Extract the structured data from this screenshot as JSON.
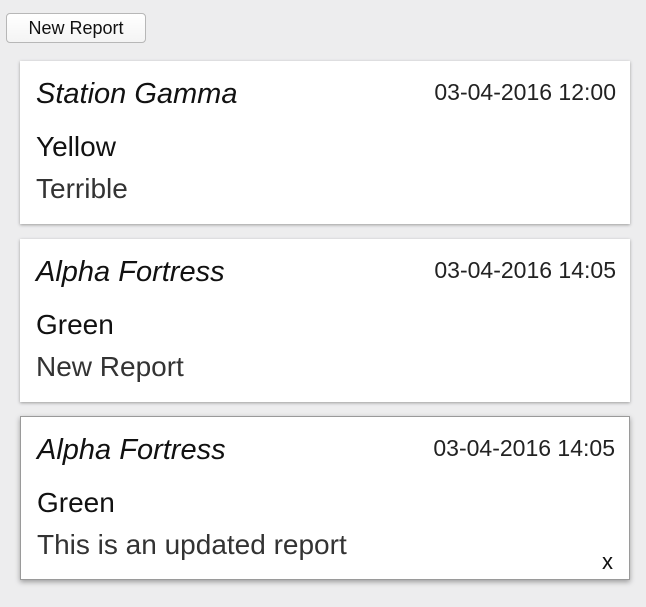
{
  "toolbar": {
    "new_report_label": "New Report"
  },
  "reports": [
    {
      "station": "Station Gamma",
      "timestamp": "03-04-2016 12:00",
      "status": "Yellow",
      "message": "Terrible"
    },
    {
      "station": "Alpha Fortress",
      "timestamp": "03-04-2016 14:05",
      "status": "Green",
      "message": "New Report"
    },
    {
      "station": "Alpha Fortress",
      "timestamp": "03-04-2016 14:05",
      "status": "Green",
      "message": "This is an updated report",
      "close_label": "x"
    }
  ]
}
